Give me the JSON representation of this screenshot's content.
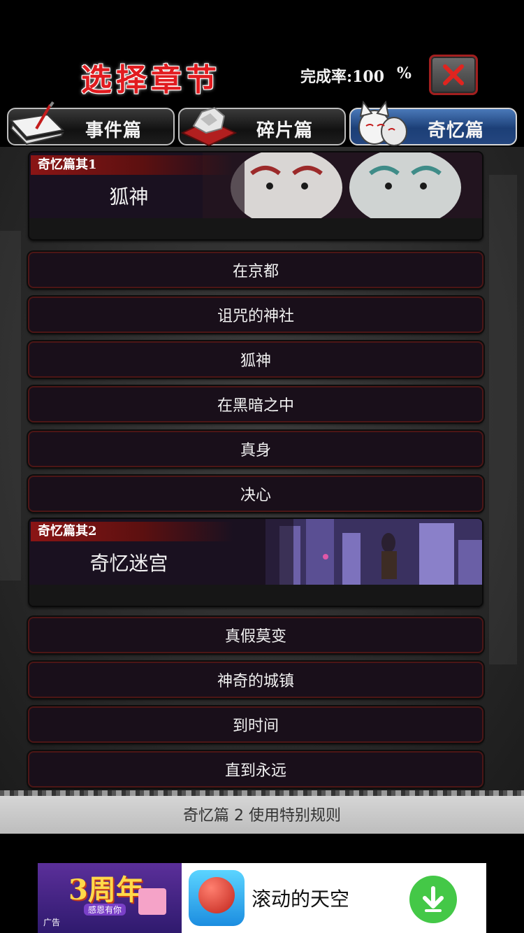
{
  "header": {
    "title": "选择章节",
    "completion_label": "完成率:100",
    "completion_unit": "%"
  },
  "tabs": [
    {
      "label": "事件篇",
      "icon": "notebook-icon",
      "active": false
    },
    {
      "label": "碎片篇",
      "icon": "fragments-icon",
      "active": false
    },
    {
      "label": "奇忆篇",
      "icon": "fox-mask-icon",
      "active": true
    }
  ],
  "chapters": [
    {
      "tag": "奇忆篇其1",
      "title": "狐神",
      "art": "fox-masks-art",
      "episodes": [
        "在京都",
        "诅咒的神社",
        "狐神",
        "在黑暗之中",
        "真身",
        "决心"
      ]
    },
    {
      "tag": "奇忆篇其2",
      "title": "奇忆迷宫",
      "art": "city-night-art",
      "episodes": [
        "真假莫变",
        "神奇的城镇",
        "到时间",
        "直到永远"
      ]
    }
  ],
  "rule_banner": "奇忆篇 2 使用特别规则",
  "ad": {
    "badge_text": "3周年",
    "badge_sub": "感恩有你",
    "ad_label": "广告",
    "app_name": "滚动的天空",
    "download_icon": "download-icon"
  },
  "colors": {
    "title_red": "#e11b1f",
    "active_tab_blue": "#24467f",
    "download_green": "#44c847"
  }
}
